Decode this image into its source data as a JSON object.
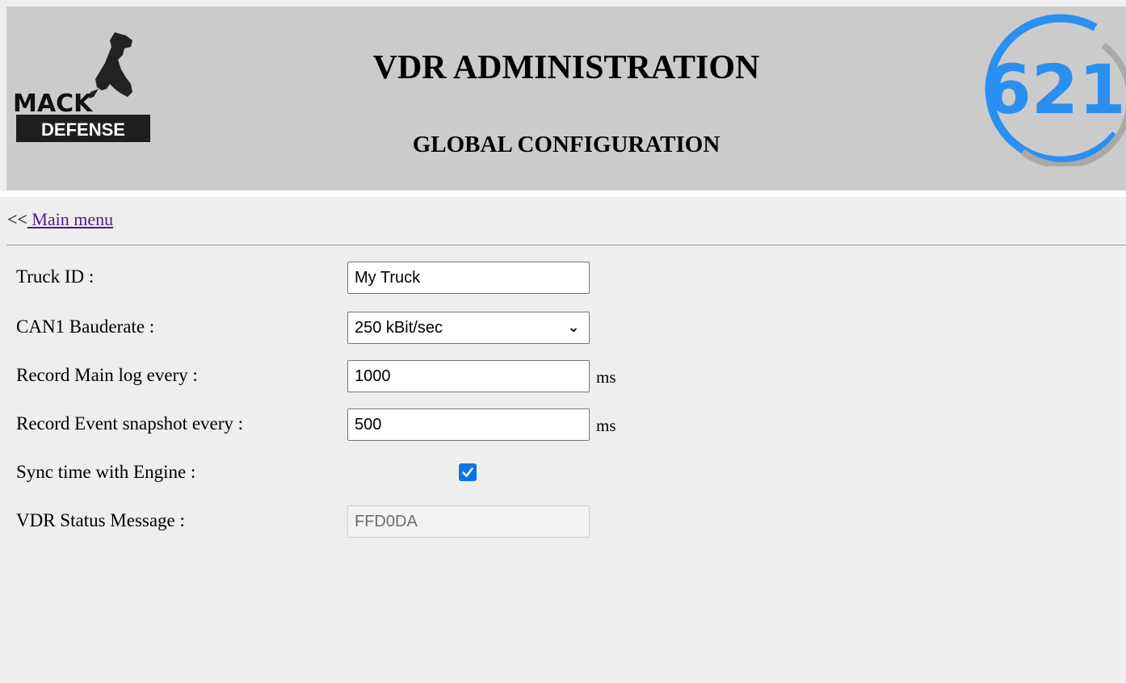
{
  "header": {
    "title": "VDR ADMINISTRATION",
    "subtitle": "GLOBAL CONFIGURATION",
    "left_logo": {
      "text_top": "MACK",
      "text_bottom": "DEFENSE",
      "icon": "bulldog-logo-icon"
    },
    "right_logo": {
      "text": "621",
      "icon": "621-ring-logo-icon",
      "accent": "#2b8ff0"
    }
  },
  "nav": {
    "prefix": "<<",
    "main_menu_label": " Main menu"
  },
  "form": {
    "truck_id": {
      "label": "Truck ID :",
      "value": "My Truck"
    },
    "can1_baudrate": {
      "label": "CAN1 Bauderate :",
      "selected": "250 kBit/sec"
    },
    "main_log": {
      "label": "Record Main log every :",
      "value": "1000",
      "unit": "ms"
    },
    "event_snapshot": {
      "label": "Record Event snapshot every :",
      "value": "500",
      "unit": "ms"
    },
    "sync_time": {
      "label": "Sync time with Engine :",
      "checked": true
    },
    "status_message": {
      "label": "VDR Status Message :",
      "value": "FFD0DA"
    }
  },
  "colors": {
    "header_bg": "#cbcbcb",
    "page_bg": "#eeeeee",
    "link": "#551a8b",
    "checkbox": "#0b75e2"
  }
}
